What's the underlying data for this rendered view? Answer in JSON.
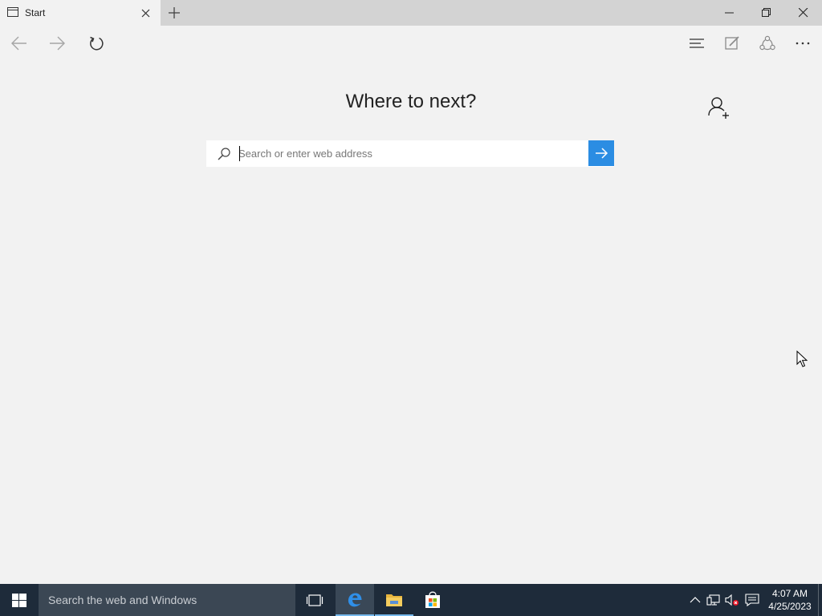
{
  "tab": {
    "title": "Start"
  },
  "window_controls": [
    "minimize",
    "restore",
    "close"
  ],
  "toolbar": {
    "left": [
      "back-arrow-icon",
      "forward-arrow-icon",
      "refresh-icon"
    ],
    "right": [
      "hub-icon",
      "web-note-icon",
      "share-icon",
      "more-icon"
    ]
  },
  "start_page": {
    "heading": "Where to next?",
    "search_placeholder": "Search or enter web address",
    "search_value": ""
  },
  "taskbar": {
    "search_placeholder": "Search the web and Windows",
    "pinned": [
      "task-view-icon",
      "edge-icon",
      "file-explorer-icon",
      "store-icon"
    ],
    "time": "4:07 AM",
    "date": "4/25/2023"
  },
  "colors": {
    "accent": "#2b8de3",
    "taskbar": "#1e2b3a",
    "taskbar_search": "#3b4754",
    "page_bg": "#f2f2f2",
    "tab_strip": "#d3d3d3"
  }
}
